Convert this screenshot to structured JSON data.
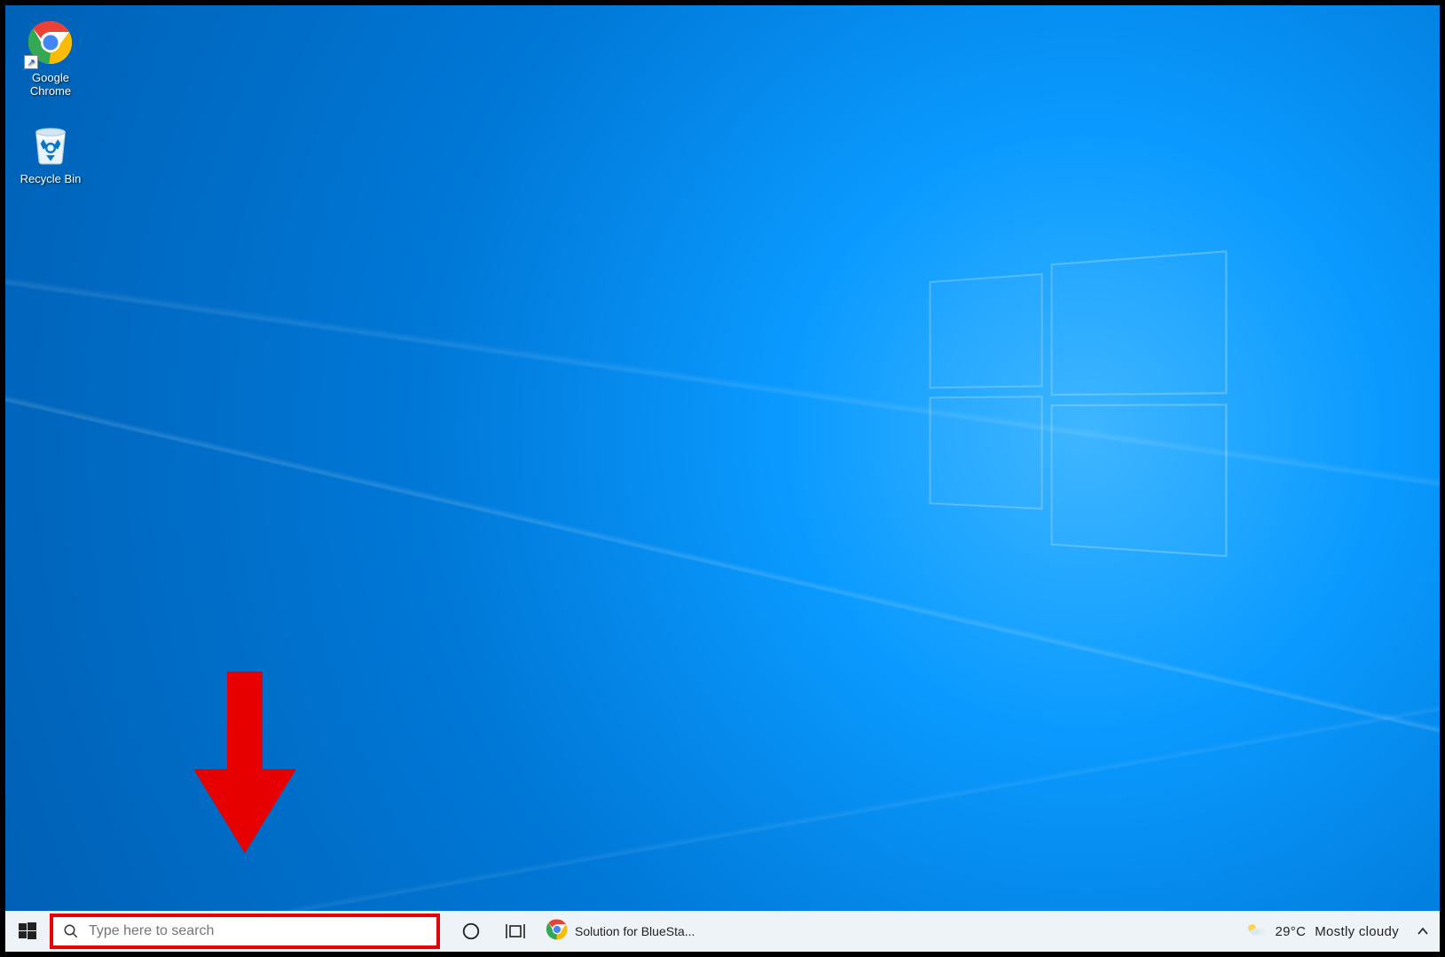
{
  "desktop": {
    "icons": [
      {
        "name": "google-chrome",
        "label": "Google\nChrome",
        "shortcut": true
      },
      {
        "name": "recycle-bin",
        "label": "Recycle Bin",
        "shortcut": false
      }
    ]
  },
  "taskbar": {
    "search": {
      "placeholder": "Type here to search",
      "value": ""
    },
    "app": {
      "label": "Solution for BlueSta..."
    },
    "weather": {
      "temp": "29°C",
      "condition": "Mostly cloudy"
    }
  },
  "annotation": {
    "color": "#e60000"
  },
  "colors": {
    "taskbar_bg": "#eef3f7",
    "desktop_accent": "#0078d7"
  }
}
